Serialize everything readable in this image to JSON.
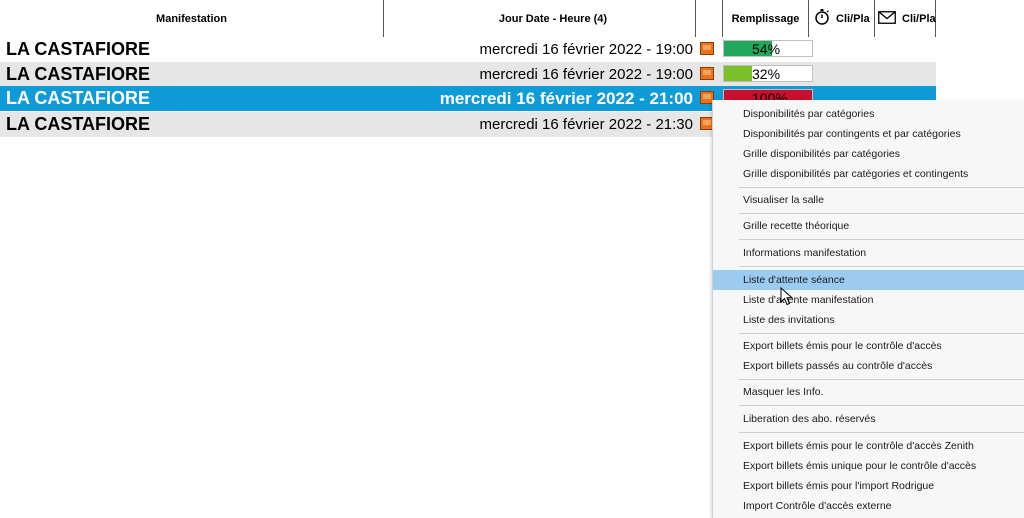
{
  "header": {
    "col_manifestation": "Manifestation",
    "col_jour_date": "Jour Date - Heure (4)",
    "col_remplissage": "Remplissage",
    "col_clipla_1": "Cli/Pla",
    "col_clipla_2": "Cli/Pla",
    "icons": [
      "stopwatch-icon",
      "envelope-icon"
    ]
  },
  "rows": [
    {
      "name": "LA CASTAFIORE",
      "datetime": "mercredi 16 février 2022 - 19:00",
      "fill_pct": 54,
      "fill_label": "54%",
      "fill_color": "#22a85c",
      "selected": false
    },
    {
      "name": "LA CASTAFIORE",
      "datetime": "mercredi 16 février 2022 - 19:00",
      "fill_pct": 32,
      "fill_label": "32%",
      "fill_color": "#7cc12a",
      "selected": false
    },
    {
      "name": "LA CASTAFIORE",
      "datetime": "mercredi 16 février 2022 - 21:00",
      "fill_pct": 100,
      "fill_label": "100%",
      "fill_color": "#c8102e",
      "selected": true
    },
    {
      "name": "LA CASTAFIORE",
      "datetime": "mercredi 16 février 2022 - 21:30",
      "fill_pct": null,
      "fill_label": "",
      "fill_color": "",
      "selected": false
    }
  ],
  "colors": {
    "selection": "#0e9bd8",
    "menu_highlight": "#9ccbf1",
    "tag": "#e8731c"
  },
  "menu": {
    "items": [
      "Disponibilités par catégories",
      "Disponibilités par contingents et par catégories",
      "Grille disponibilités par catégories",
      "Grille disponibilités par catégories et contingents",
      "Visualiser la salle",
      "Grille recette théorique",
      "Informations manifestation",
      "Liste d'attente séance",
      "Liste d'attente manifestation",
      "Liste des invitations",
      "Export billets émis pour le contrôle d'accès",
      "Export billets passés au contrôle d'accès",
      "Masquer les Info.",
      "Liberation des abo. réservés",
      "Export billets émis pour le contrôle d'accès Zenith",
      "Export billets émis unique pour le contrôle d'accès",
      "Export billets émis pour l'import Rodrigue",
      "Import Contrôle d'accès externe"
    ],
    "highlighted_index": 7
  }
}
